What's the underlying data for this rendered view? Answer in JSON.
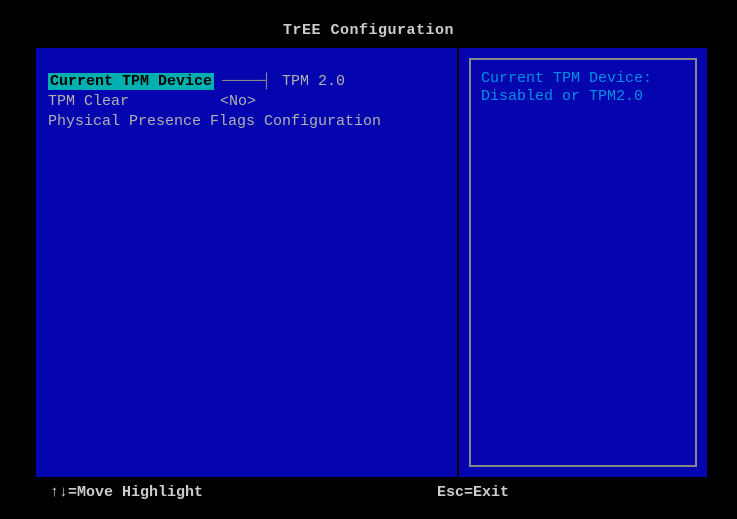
{
  "title": "TrEE Configuration",
  "menu": {
    "items": [
      {
        "label": "Current TPM Device",
        "value": "TPM 2.0",
        "selected": true
      },
      {
        "label": "TPM Clear",
        "value": "<No>",
        "selected": false
      },
      {
        "label": "Physical Presence Flags Configuration",
        "value": "",
        "selected": false
      }
    ]
  },
  "help": {
    "line1": "Current TPM Device:",
    "line2": "Disabled or TPM2.0"
  },
  "footer": {
    "left": "↑↓=Move Highlight",
    "right": "Esc=Exit"
  }
}
